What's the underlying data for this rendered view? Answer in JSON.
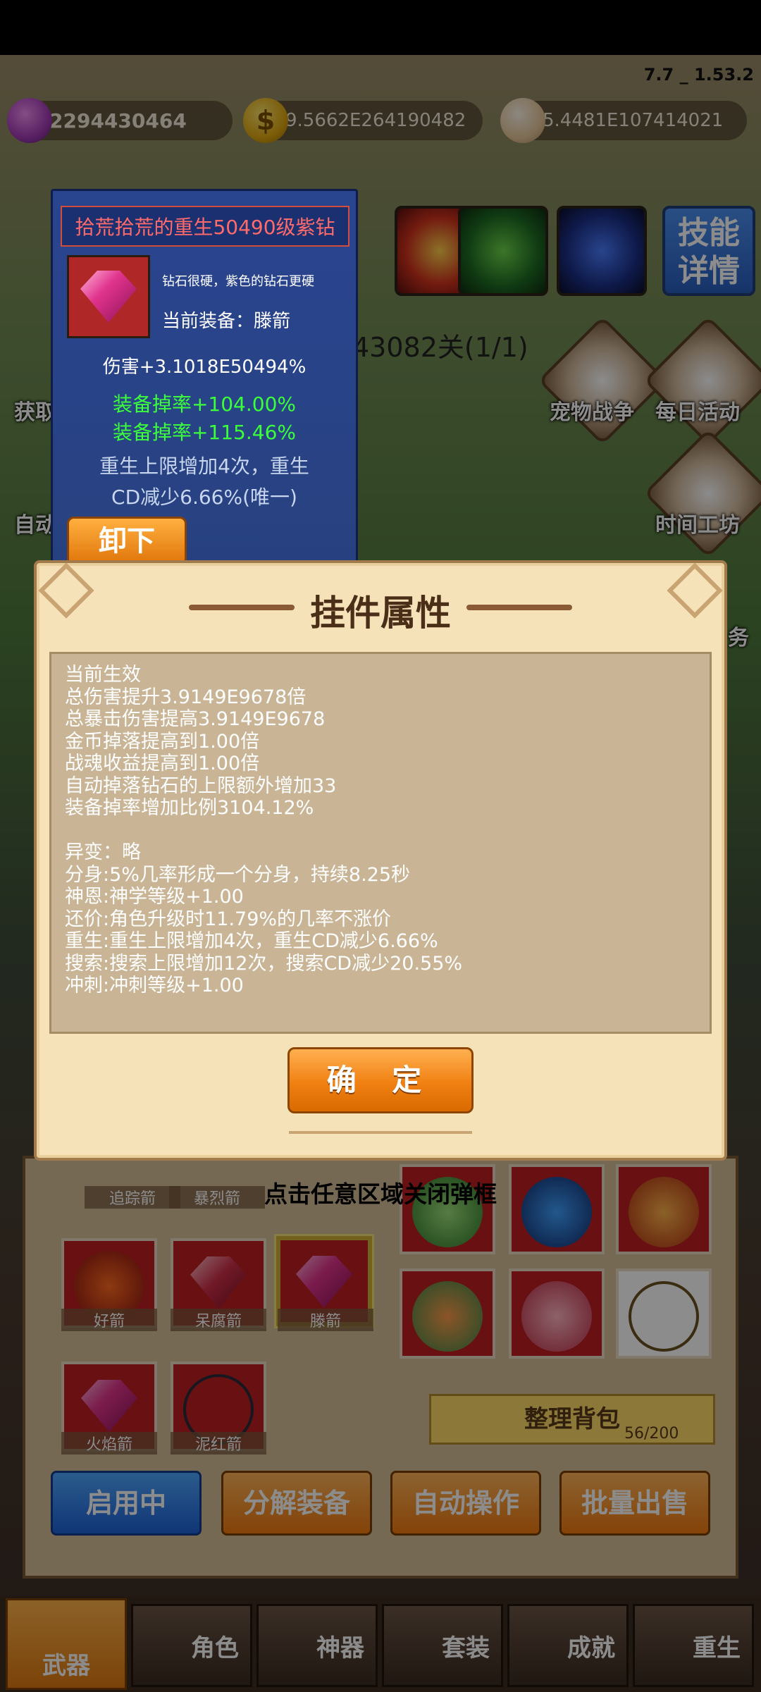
{
  "version": "7.7 _ 1.53.2",
  "currencies": {
    "gems": "2294430464",
    "gold": "9.5662E264190482",
    "souls": "5.4481E107414021"
  },
  "top": {
    "skill_detail": "技能\n详情",
    "level": "43082关(1/1)"
  },
  "side_buttons": {
    "left1": "获取",
    "left2": "自动",
    "pet_war": "宠物战争",
    "daily": "每日活动",
    "time_workshop": "时间工坊",
    "task": "务"
  },
  "equip": {
    "title": "拾荒拾荒的重生50490级紫钻",
    "desc": "钻石很硬，紫色的钻石更硬",
    "current": "当前装备：滕箭",
    "damage": "伤害+3.1018E50494%",
    "drop1": "装备掉率+104.00%",
    "drop2": "装备掉率+115.46%",
    "rebirth": "重生上限增加4次，重生\nCD减少6.66%(唯一)",
    "unload": "卸下"
  },
  "dialog": {
    "title": "挂件属性",
    "body": "当前生效\n总伤害提升3.9149E9678倍\n总暴击伤害提高3.9149E9678\n金币掉落提高到1.00倍\n战魂收益提高到1.00倍\n自动掉落钻石的上限额外增加33\n装备掉率增加比例3104.12%\n\n异变：略\n分身:5%几率形成一个分身，持续8.25秒\n神恩:神学等级+1.00\n还价:角色升级时11.79%的几率不涨价\n重生:重生上限增加4次，重生CD减少6.66%\n搜索:搜索上限增加12次，搜索CD减少20.55%\n冲刺:冲刺等级+1.00",
    "ok": "确 定"
  },
  "inventory": {
    "tap_close": "点击任意区域关闭弹框",
    "row0": [
      "追踪箭",
      "暴烈箭"
    ],
    "items": [
      "好箭",
      "呆腐箭",
      "滕箭",
      "火焰箭",
      "泥红箭"
    ],
    "sort": "整理背包",
    "capacity": "56/200"
  },
  "actions": {
    "enabled": "启用中",
    "decompose": "分解装备",
    "auto": "自动操作",
    "bulk_sell": "批量出售"
  },
  "nav": [
    "武器",
    "角色",
    "神器",
    "套装",
    "成就",
    "重生"
  ]
}
